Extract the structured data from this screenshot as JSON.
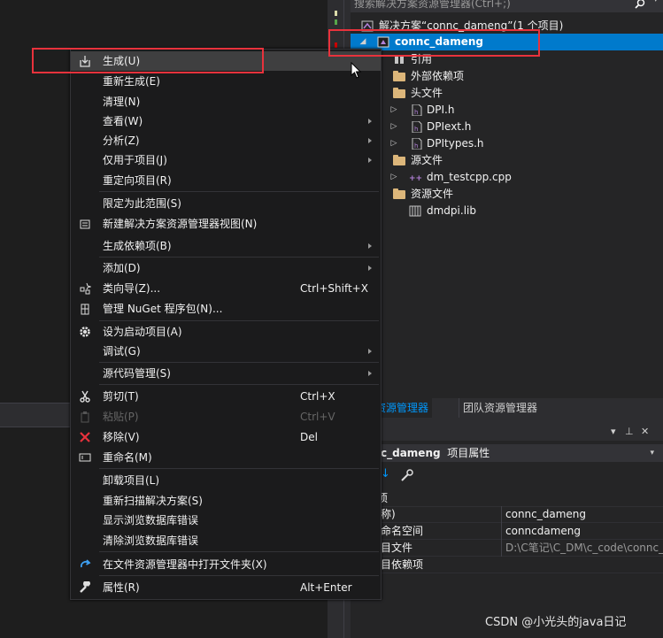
{
  "solution_explorer": {
    "search_placeholder": "搜索解决方案资源管理器(Ctrl+;)",
    "items": [
      {
        "label": "解决方案“connc_dameng”(1 个项目)",
        "icon": "solution-icon"
      },
      {
        "label": "connc_dameng",
        "icon": "project-icon",
        "selected": true
      },
      {
        "label": "引用",
        "icon": "references-icon"
      },
      {
        "label": "外部依赖项",
        "icon": "folder-icon"
      },
      {
        "label": "头文件",
        "icon": "folder-icon"
      },
      {
        "label": "DPI.h",
        "icon": "header-file-icon"
      },
      {
        "label": "DPIext.h",
        "icon": "header-file-icon"
      },
      {
        "label": "DPItypes.h",
        "icon": "header-file-icon"
      },
      {
        "label": "源文件",
        "icon": "folder-icon"
      },
      {
        "label": "dm_testcpp.cpp",
        "icon": "cpp-file-icon"
      },
      {
        "label": "资源文件",
        "icon": "folder-icon"
      },
      {
        "label": "dmdpi.lib",
        "icon": "library-icon"
      }
    ]
  },
  "tabs": [
    {
      "label": "方案资源管理器"
    },
    {
      "label": "团队资源管理器"
    }
  ],
  "properties": {
    "object_name": "c_dameng",
    "object_suffix": "项目属性",
    "category": "项",
    "rows": [
      {
        "key": "称)",
        "value": "connc_dameng"
      },
      {
        "key": "命名空间",
        "value": "conncdameng"
      },
      {
        "key": "目文件",
        "value": "D:\\C笔记\\C_DM\\c_code\\connc_"
      },
      {
        "key": "目依赖项",
        "value": ""
      }
    ]
  },
  "context_menu": {
    "items": [
      {
        "label": "生成(U)",
        "icon": "build-icon",
        "shortcut": "",
        "submenu": false,
        "hover": true
      },
      {
        "label": "重新生成(E)",
        "shortcut": "",
        "submenu": false
      },
      {
        "label": "清理(N)",
        "shortcut": "",
        "submenu": false
      },
      {
        "label": "查看(W)",
        "shortcut": "",
        "submenu": true
      },
      {
        "label": "分析(Z)",
        "shortcut": "",
        "submenu": true
      },
      {
        "label": "仅用于项目(J)",
        "shortcut": "",
        "submenu": true
      },
      {
        "label": "重定向项目(R)",
        "shortcut": "",
        "submenu": false
      },
      {
        "label": "限定为此范围(S)",
        "shortcut": "",
        "submenu": false
      },
      {
        "label": "新建解决方案资源管理器视图(N)",
        "icon": "new-view-icon",
        "shortcut": "",
        "submenu": false
      },
      {
        "label": "生成依赖项(B)",
        "shortcut": "",
        "submenu": true
      },
      {
        "label": "添加(D)",
        "shortcut": "",
        "submenu": true
      },
      {
        "label": "类向导(Z)...",
        "icon": "class-wizard-icon",
        "shortcut": "Ctrl+Shift+X",
        "submenu": false
      },
      {
        "label": "管理 NuGet 程序包(N)...",
        "icon": "nuget-icon",
        "shortcut": "",
        "submenu": false
      },
      {
        "label": "设为启动项目(A)",
        "icon": "gear-icon",
        "shortcut": "",
        "submenu": false
      },
      {
        "label": "调试(G)",
        "shortcut": "",
        "submenu": true
      },
      {
        "label": "源代码管理(S)",
        "shortcut": "",
        "submenu": true
      },
      {
        "label": "剪切(T)",
        "icon": "scissors-icon",
        "shortcut": "Ctrl+X",
        "submenu": false
      },
      {
        "label": "粘贴(P)",
        "icon": "paste-icon",
        "shortcut": "Ctrl+V",
        "submenu": false,
        "disabled": true
      },
      {
        "label": "移除(V)",
        "icon": "remove-icon",
        "shortcut": "Del",
        "submenu": false
      },
      {
        "label": "重命名(M)",
        "icon": "rename-icon",
        "shortcut": "",
        "submenu": false
      },
      {
        "label": "卸载项目(L)",
        "shortcut": "",
        "submenu": false
      },
      {
        "label": "重新扫描解决方案(S)",
        "shortcut": "",
        "submenu": false
      },
      {
        "label": "显示浏览数据库错误",
        "shortcut": "",
        "submenu": false
      },
      {
        "label": "清除浏览数据库错误",
        "shortcut": "",
        "submenu": false
      },
      {
        "label": "在文件资源管理器中打开文件夹(X)",
        "icon": "open-folder-icon",
        "shortcut": "",
        "submenu": false
      },
      {
        "label": "属性(R)",
        "icon": "wrench-icon",
        "shortcut": "Alt+Enter",
        "submenu": false
      }
    ]
  },
  "watermark": "CSDN @小光头的java日记",
  "colors": {
    "accent": "#007acc",
    "highlight": "#e8323c"
  }
}
